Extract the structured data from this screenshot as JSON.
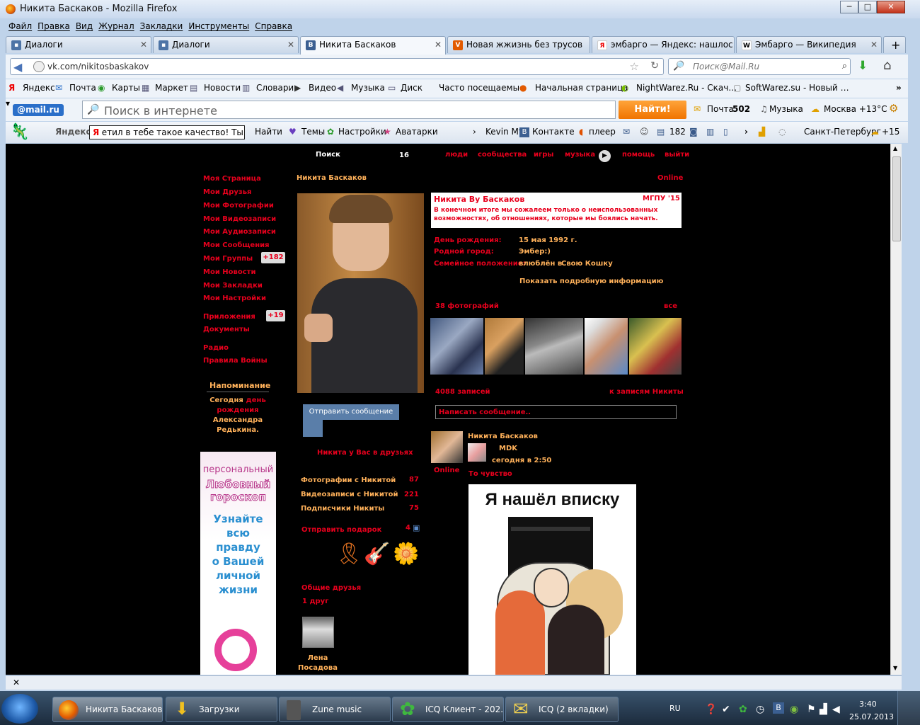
{
  "window": {
    "title": "Никита Баскаков - Mozilla Firefox",
    "controls": [
      "─",
      "□",
      "✕"
    ]
  },
  "menu": [
    "Файл",
    "Правка",
    "Вид",
    "Журнал",
    "Закладки",
    "Инструменты",
    "Справка"
  ],
  "tabs": [
    {
      "label": "Диалоги",
      "icon": "vk-icon"
    },
    {
      "label": "Диалоги",
      "icon": "vk-icon"
    },
    {
      "label": "Никита Баскаков",
      "icon": "vk-icon",
      "active": true
    },
    {
      "label": "Новая жжизнь без трусов",
      "icon": "v-icon"
    },
    {
      "label": "эмбарго — Яндекс: нашлос…",
      "icon": "yandex-icon"
    },
    {
      "label": "Эмбарго — Википедия",
      "icon": "wikipedia-icon"
    }
  ],
  "nav": {
    "url": "vk.com/nikitosbaskakov",
    "search_placeholder": "Поиск@Mail.Ru"
  },
  "bookmarks": [
    "Яндекс",
    "Почта",
    "Карты",
    "Маркет",
    "Новости",
    "Словари",
    "Видео",
    "Музыка",
    "Диск",
    "Часто посещаемые",
    "Начальная страница",
    "NightWarez.Ru - Скач…",
    "SoftWarez.su - Новый …"
  ],
  "mailru": {
    "logo": "@mail.ru",
    "search_placeholder": "Поиск в интернете",
    "find_button": "Найти!",
    "mail": "Почта",
    "mail_count": "502",
    "music": "Музыка",
    "weather": "Москва +13°C"
  },
  "yandexbar": {
    "logo": "Яндекс",
    "input": "етил в тебе такое качество! Ты очень",
    "find": "Найти",
    "themes": "Темы",
    "settings": "Настройки",
    "avatars": "Аватарки",
    "user": "Kevin Mf",
    "contacts": "Контакте",
    "player": "плеер",
    "count": "182",
    "city": "Санкт-Петербург",
    "temp": "+15"
  },
  "vk": {
    "top": {
      "search": "Поиск",
      "count": "16",
      "links": [
        "люди",
        "сообщества",
        "игры",
        "музыка",
        "помощь",
        "выйти"
      ]
    },
    "left_menu": [
      "Моя Страница",
      "Мои Друзья",
      "Мои Фотографии",
      "Мои Видеозаписи",
      "Мои Аудиозаписи",
      "Мои Сообщения",
      "Мои Группы",
      "Мои Новости",
      "Мои Закладки",
      "Мои Настройки"
    ],
    "groups_badge": "+182",
    "apps": "Приложения",
    "apps_badge": "+19",
    "docs": "Документы",
    "radio": "Радио",
    "rules": "Правила Войны",
    "reminder": {
      "title": "Напоминание",
      "today": "Сегодня",
      "text1": "день",
      "text2": "рождения",
      "name1": "Александра",
      "name2": "Редькина."
    },
    "ad": {
      "l1": "персональный",
      "l2": "Любовный",
      "l3": "гороскоп",
      "l4": "Узнайте",
      "l5": "всю",
      "l6": "правду",
      "l7": "о Вашей",
      "l8": "личной",
      "l9": "жизни"
    },
    "profile_name": "Никита Баскаков",
    "online": "Online",
    "status_name": "Никита Ву Баскаков",
    "status_uni": "МГПУ '15",
    "status_l1": "В конечном итоге мы сожалеем только о неиспользованных",
    "status_l2": "возможностях, об отношениях, которые мы боялись начать.",
    "info": [
      {
        "k": "День рождения:",
        "v": "15 мая 1992 г."
      },
      {
        "k": "Родной город:",
        "v": "Эмбер:)"
      },
      {
        "k": "Семейное положение:",
        "v": "влюблён в",
        "v2": "Свою Кошку"
      }
    ],
    "more_info": "Показать подробную информацию",
    "photos_count": "38 фотографий",
    "photos_all": "все",
    "send_message": "Отправить сообщение",
    "in_friends": "Никита у Вас в друзьях",
    "stats": [
      {
        "k": "Фотографии с Никитой",
        "v": "87"
      },
      {
        "k": "Видеозаписи с Никитой",
        "v": "221"
      },
      {
        "k": "Подписчики Никиты",
        "v": "75"
      }
    ],
    "gift": "Отправить подарок",
    "gift_count": "4",
    "mutual": "Общие друзья",
    "mutual_count": "1 друг",
    "friend": {
      "first": "Лена",
      "last": "Посадова"
    },
    "wall_count": "4088 записей",
    "wall_link": "к записям Никиты",
    "write_placeholder": "Написать сообщение..",
    "post": {
      "author": "Никита Баскаков",
      "group": "MDK",
      "time": "сегодня в 2:50",
      "text": "То чувство",
      "online": "Online",
      "image_caption": "Я нашёл вписку"
    }
  },
  "findbar": {
    "close": "✕"
  },
  "taskbar": {
    "tasks": [
      "Никита Баскаков...",
      "Загрузки",
      "Zune music",
      "ICQ Клиент - 202...",
      "ICQ (2 вкладки)"
    ],
    "lang": "RU",
    "time": "3:40",
    "date": "25.07.2013"
  }
}
